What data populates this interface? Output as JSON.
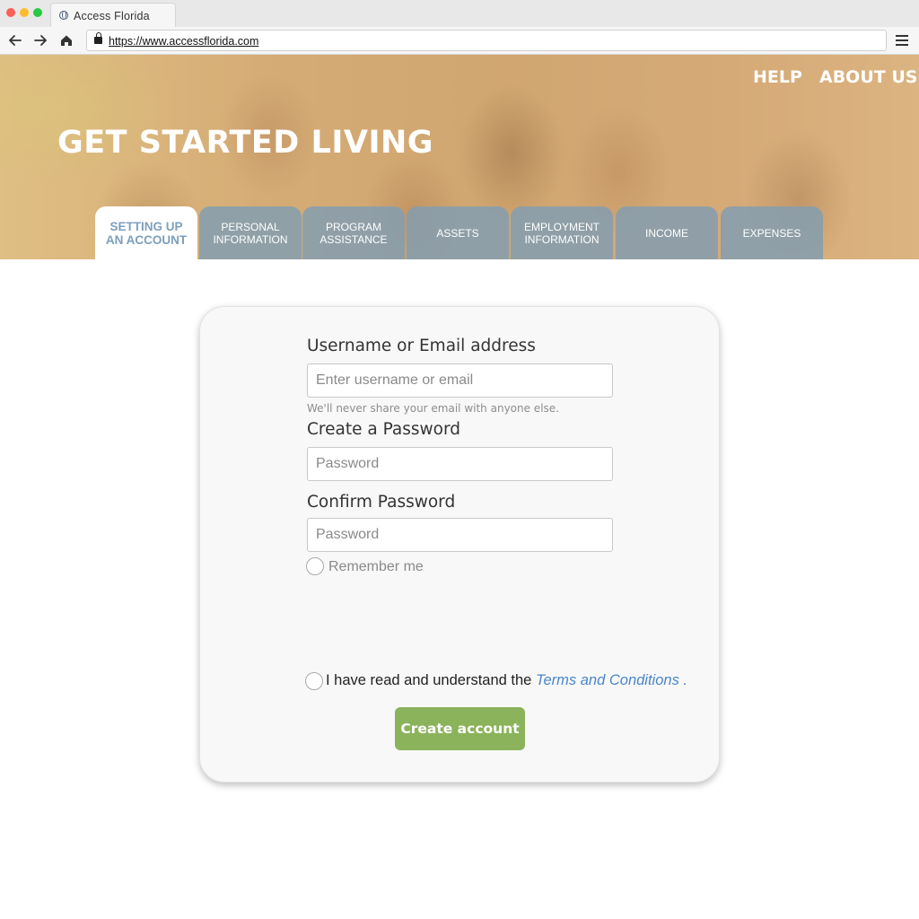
{
  "browser": {
    "tab_title": "Access  Florida",
    "url": "https://www.accessflorida.com"
  },
  "hero": {
    "headline": "GET STARTED LIVING",
    "links": {
      "help": "HELP",
      "about": "ABOUT US"
    }
  },
  "steps": [
    {
      "label": "SETTING UP\nAN ACCOUNT",
      "active": true
    },
    {
      "label": "PERSONAL\nINFORMATION",
      "active": false
    },
    {
      "label": "PROGRAM\nASSISTANCE",
      "active": false
    },
    {
      "label": "ASSETS",
      "active": false
    },
    {
      "label": "EMPLOYMENT\nINFORMATION",
      "active": false
    },
    {
      "label": "INCOME",
      "active": false
    },
    {
      "label": "EXPENSES",
      "active": false
    }
  ],
  "form": {
    "username": {
      "label": "Username or Email address",
      "placeholder": "Enter username or email",
      "value": "",
      "helper": "We'll never share your email with anyone else."
    },
    "password": {
      "label": "Create a Password",
      "placeholder": "Password",
      "value": ""
    },
    "confirm": {
      "label": "Confirm  Password",
      "placeholder": "Password",
      "value": ""
    },
    "remember": {
      "label": "Remember me",
      "checked": false
    },
    "terms": {
      "prefix": "I have read and understand the ",
      "link": "Terms and Conditions",
      "suffix": " .",
      "checked": false
    },
    "submit_label": "Create account"
  },
  "colors": {
    "accent_green": "#8bb35b",
    "tab_blue": "#849eb0",
    "active_tab_text": "#7d9fbc",
    "link_blue": "#4a86c8"
  },
  "icons": {
    "back": "arrow-left-icon",
    "forward": "arrow-right-icon",
    "home": "home-icon",
    "lock": "lock-icon",
    "menu": "hamburger-menu-icon",
    "site": "globe-icon"
  }
}
